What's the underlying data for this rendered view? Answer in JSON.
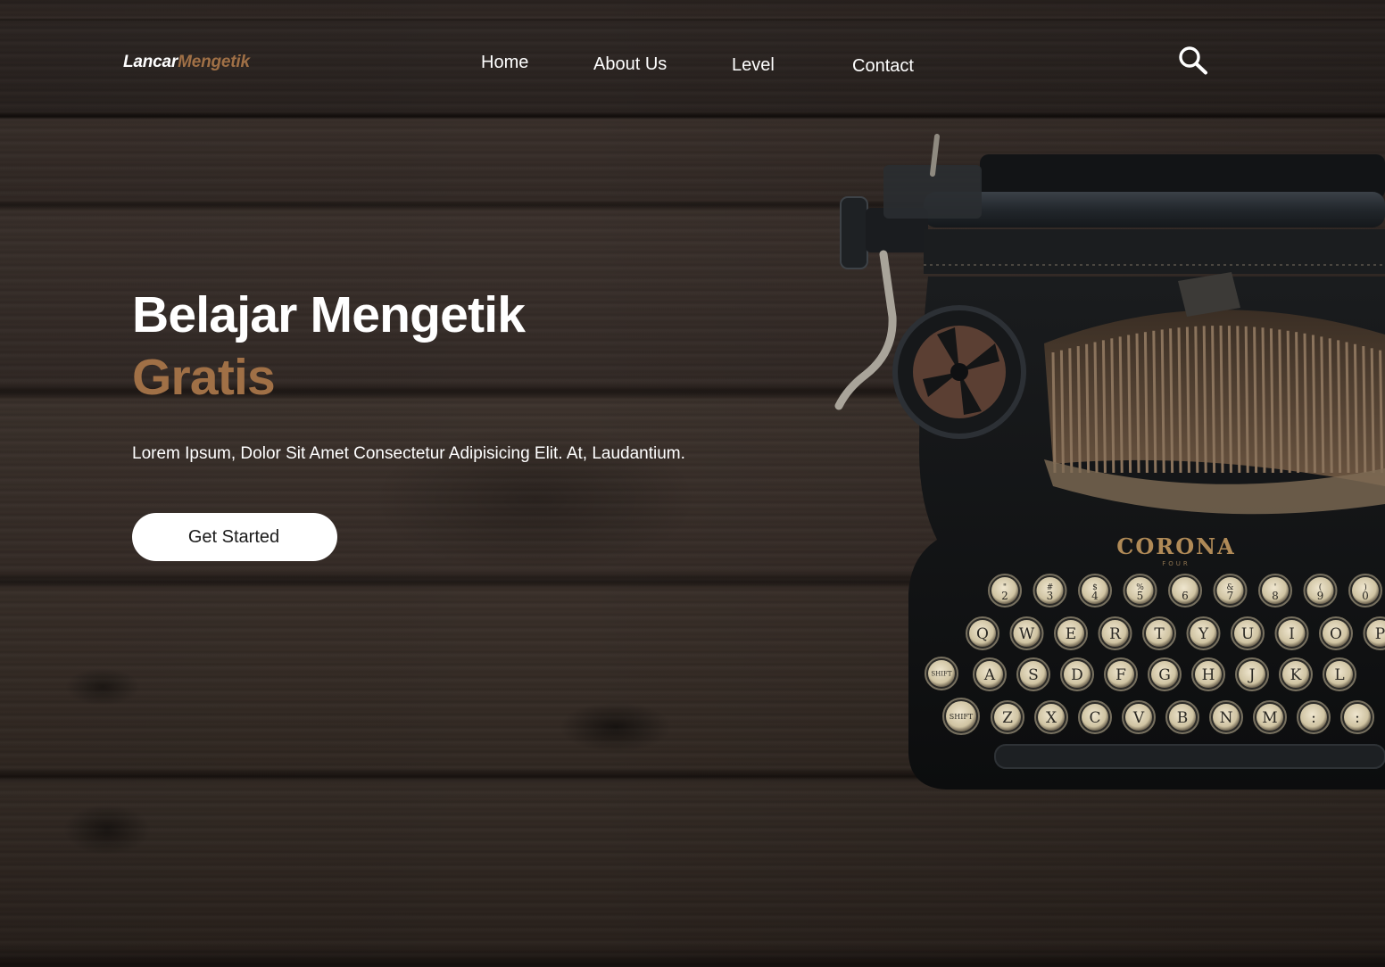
{
  "brand": {
    "part1": "Lancar",
    "part2": "Mengetik",
    "accent_color": "#a07046"
  },
  "nav": {
    "items": [
      {
        "label": "Home"
      },
      {
        "label": "About Us"
      },
      {
        "label": "Level"
      },
      {
        "label": "Contact"
      }
    ],
    "search_icon": "search-icon"
  },
  "hero": {
    "title": "Belajar Mengetik",
    "accent": "Gratis",
    "description": "Lorem Ipsum, Dolor Sit Amet Consectetur Adipisicing Elit. At, Laudantium.",
    "cta_label": "Get Started"
  },
  "typewriter": {
    "brand": "CORONA",
    "model": "FOUR",
    "number_row": [
      "2",
      "3",
      "4",
      "5",
      "6",
      "7",
      "8",
      "9",
      "0"
    ],
    "number_row_top": [
      "\"",
      "#",
      "$",
      "%",
      "_",
      "&",
      "'",
      "(",
      ")"
    ],
    "row1": [
      "Q",
      "W",
      "E",
      "R",
      "T",
      "Y",
      "U",
      "I",
      "O",
      "P"
    ],
    "row2": [
      "A",
      "S",
      "D",
      "F",
      "G",
      "H",
      "J",
      "K",
      "L"
    ],
    "row3": [
      "Z",
      "X",
      "C",
      "V",
      "B",
      "N",
      "M",
      ":",
      ":"
    ],
    "shift_lock": "SHIFT LOCK",
    "shift": "SHIFT"
  }
}
